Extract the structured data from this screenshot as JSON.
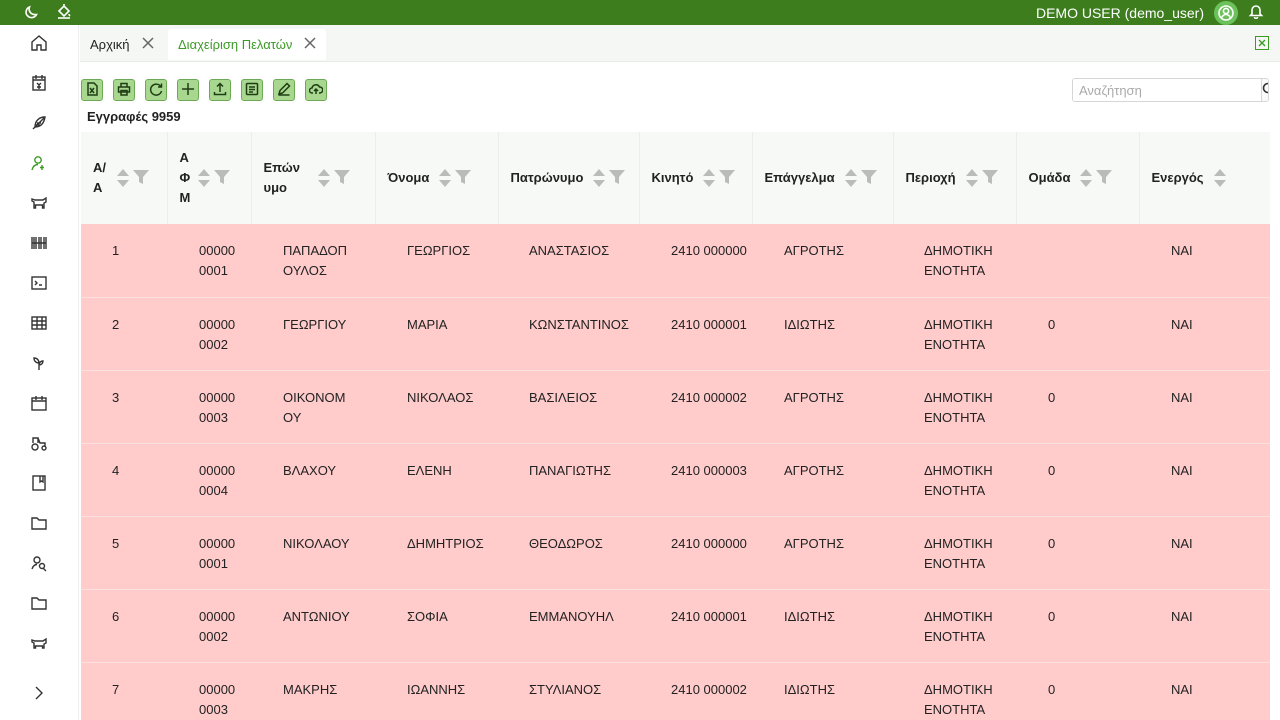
{
  "app": {
    "user_label": "DEMO USER (demo_user)"
  },
  "tabs": [
    {
      "label": "Αρχική"
    },
    {
      "label": "Διαχείριση Πελατών"
    }
  ],
  "toolbar": {
    "buttons": [
      "excel-export-icon",
      "print-icon",
      "refresh-icon",
      "add-icon",
      "upload-icon",
      "copy-icon",
      "edit-icon",
      "cloud-upload-icon"
    ]
  },
  "search": {
    "placeholder": "Αναζήτηση"
  },
  "records_label": "Εγγραφές 9959",
  "table": {
    "columns": [
      "Α/Α",
      "Α Φ Μ",
      "Επώνυμο",
      "Όνομα",
      "Πατρώνυμο",
      "Κινητό",
      "Επάγγελμα",
      "Περιοχή",
      "Ομάδα",
      "Ενεργός"
    ],
    "rows": [
      [
        "1",
        "000000001",
        "ΠΑΠΑΔΟΠΟΥΛΟΣ",
        "ΓΕΩΡΓΙΟΣ",
        "ΑΝΑΣΤΑΣΙΟΣ",
        "2410 000000",
        "ΑΓΡΟΤΗΣ",
        "ΔΗΜΟΤΙΚΗ ΕΝΟΤΗΤΑ",
        "",
        "ΝΑΙ"
      ],
      [
        "2",
        "000000002",
        "ΓΕΩΡΓΙΟΥ",
        "ΜΑΡΙΑ",
        "ΚΩΝΣΤΑΝΤΙΝΟΣ",
        "2410 000001",
        "ΙΔΙΩΤΗΣ",
        "ΔΗΜΟΤΙΚΗ ΕΝΟΤΗΤΑ",
        "0",
        "ΝΑΙ"
      ],
      [
        "3",
        "000000003",
        "ΟΙΚΟΝΟΜΟΥ",
        "ΝΙΚΟΛΑΟΣ",
        "ΒΑΣΙΛΕΙΟΣ",
        "2410 000002",
        "ΑΓΡΟΤΗΣ",
        "ΔΗΜΟΤΙΚΗ ΕΝΟΤΗΤΑ",
        "0",
        "ΝΑΙ"
      ],
      [
        "4",
        "000000004",
        "ΒΛΑΧΟΥ",
        "ΕΛΕΝΗ",
        "ΠΑΝΑΓΙΩΤΗΣ",
        "2410 000003",
        "ΑΓΡΟΤΗΣ",
        "ΔΗΜΟΤΙΚΗ ΕΝΟΤΗΤΑ",
        "0",
        "ΝΑΙ"
      ],
      [
        "5",
        "000000001",
        "ΝΙΚΟΛΑΟΥ",
        "ΔΗΜΗΤΡΙΟΣ",
        "ΘΕΟΔΩΡΟΣ",
        "2410 000000",
        "ΑΓΡΟΤΗΣ",
        "ΔΗΜΟΤΙΚΗ ΕΝΟΤΗΤΑ",
        "0",
        "ΝΑΙ"
      ],
      [
        "6",
        "000000002",
        "ΑΝΤΩΝΙΟΥ",
        "ΣΟΦΙΑ",
        "ΕΜΜΑΝΟΥΗΛ",
        "2410 000001",
        "ΙΔΙΩΤΗΣ",
        "ΔΗΜΟΤΙΚΗ ΕΝΟΤΗΤΑ",
        "0",
        "ΝΑΙ"
      ],
      [
        "7",
        "000000003",
        "ΜΑΚΡΗΣ",
        "ΙΩΑΝΝΗΣ",
        "ΣΤΥΛΙΑΝΟΣ",
        "2410 000002",
        "ΙΔΙΩΤΗΣ",
        "ΔΗΜΟΤΙΚΗ ΕΝΟΤΗΤΑ",
        "0",
        "ΝΑΙ"
      ]
    ]
  },
  "sidebar": {
    "items": [
      "home-icon",
      "invoice-icon",
      "feather-icon",
      "customer-icon",
      "livestock-icon",
      "barcode-icon",
      "terminal-icon",
      "table-icon",
      "plant-icon",
      "calendar-icon",
      "tractor-icon",
      "book-icon",
      "folder-icon",
      "user-search-icon",
      "folder-icon",
      "animal-icon"
    ],
    "expand_icon": "chevron-right-icon"
  },
  "colors": {
    "brand_green": "#3d7d1e",
    "accent_green": "#3d9a28",
    "row_highlight": "#ffcbcb"
  }
}
